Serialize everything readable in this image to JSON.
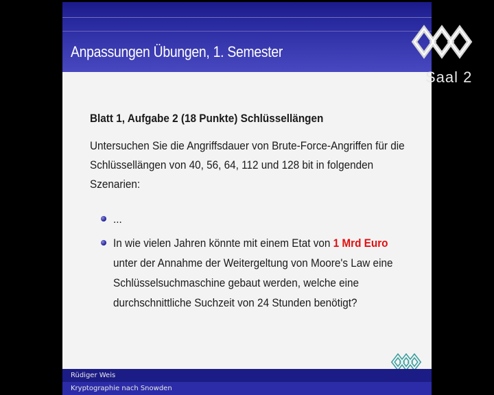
{
  "channel": {
    "label": "Saal 2",
    "logo_icon": "ccc-logo-icon"
  },
  "slide": {
    "title": "Anpassungen Übungen, 1. Semester",
    "heading": "Blatt 1, Aufgabe 2 (18 Punkte) Schlüssellängen",
    "intro": "Untersuchen Sie die Angriffsdauer von Brute-Force-Angriffen für die Schlüssellängen von 40, 56, 64, 112 und 128 bit in folgenden Szenarien:",
    "bullets": {
      "first": "...",
      "second_before": "In wie vielen Jahren könnte mit einem Etat von ",
      "second_highlight": "1 Mrd Euro",
      "second_after": " unter der Annahme der Weitergeltung von Moore's Law eine Schlüsselsuchmaschine gebaut werden, welche eine durchschnittliche Suchzeit von 24 Stunden benötigt?"
    },
    "footer": {
      "author": "Rüdiger Weis",
      "talk": "Kryptographie nach Snowden"
    },
    "colors": {
      "highlight": "#e01010",
      "title_bar": "#2a2aa0"
    }
  }
}
